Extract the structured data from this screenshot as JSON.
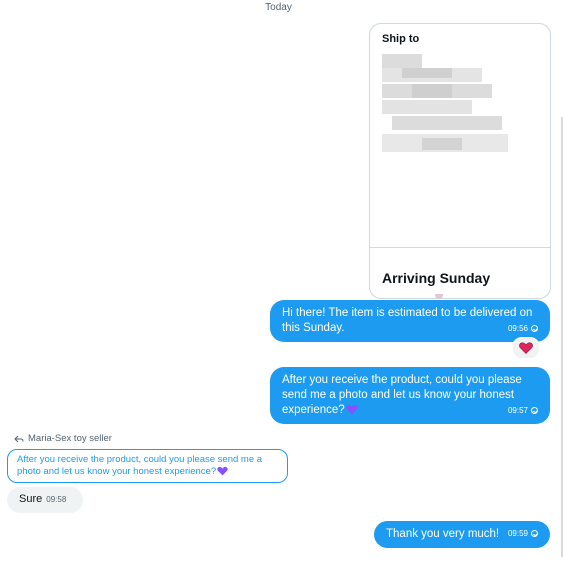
{
  "date_separator": "Today",
  "ship_card": {
    "title": "Ship to",
    "arriving": "Arriving Sunday"
  },
  "messages": [
    {
      "text": "Hi there! The item is estimated to be delivered on this Sunday.",
      "time": "09:56",
      "reaction": "heart-icon"
    },
    {
      "text": "After you receive the product, could you please send me a photo and let us know your honest experience?",
      "emoji": "purple-heart",
      "time": "09:57"
    },
    {
      "text": "Thank you very much!",
      "time": "09:59"
    }
  ],
  "reply": {
    "label": "Maria-Sex toy seller",
    "quoted": "After you receive the product, could you please send me a photo and let us know your honest experience?",
    "text": "Sure",
    "time": "09:58"
  },
  "colors": {
    "accent": "#1d9bf0",
    "incoming_bg": "#eff3f4",
    "heart": "#e0245e",
    "purple_heart": "#8a4fff"
  }
}
